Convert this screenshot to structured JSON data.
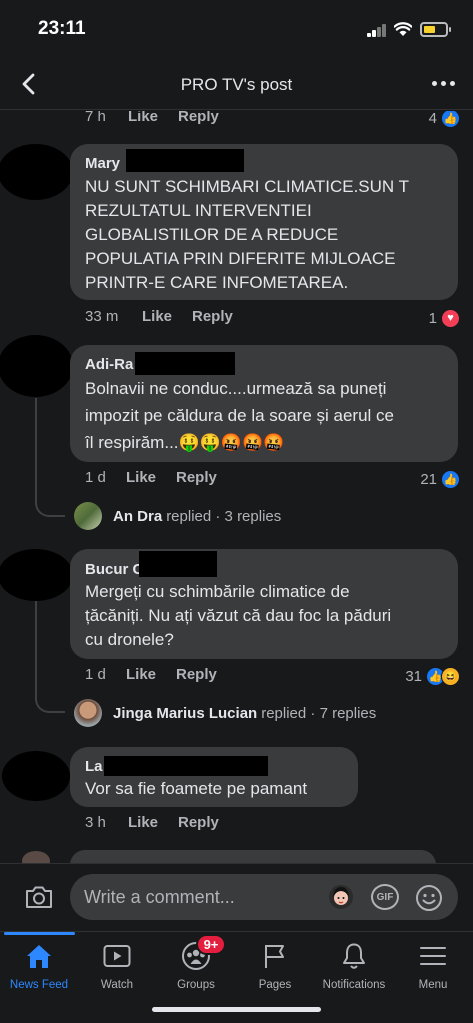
{
  "status_bar": {
    "time": "23:11"
  },
  "header": {
    "title": "PRO TV's post"
  },
  "comments": [
    {
      "time": "7 h",
      "like_label": "Like",
      "reply_label": "Reply",
      "reaction_count": "4",
      "reactions": [
        "like"
      ]
    },
    {
      "author": "Mary",
      "text": "NU SUNT SCHIMBARI CLIMATICE.SUN T\nREZULTATUL INTERVENTIEI\nGLOBALISTILOR DE A REDUCE\nPOPULATIA PRIN DIFERITE MIJLOACE\nPRINTR-E CARE INFOMETAREA.",
      "time": "33 m",
      "like_label": "Like",
      "reply_label": "Reply",
      "reaction_count": "1",
      "reactions": [
        "love"
      ]
    },
    {
      "author": "Adi-Ra",
      "text": "Bolnavii ne conduc....urmează sa puneți\nimpozit pe căldura de la soare și aerul ce\nîl respirăm...🤑🤑🤬🤬🤬",
      "time": "1 d",
      "like_label": "Like",
      "reply_label": "Reply",
      "reaction_count": "21",
      "reactions": [
        "like"
      ],
      "replies": {
        "name": "An Dra",
        "action": "replied",
        "count": "· 3 replies"
      }
    },
    {
      "author": "Bucur C",
      "text": "Mergeți cu schimbările climatice de\nțăcăniți. Nu ați văzut că dau foc la păduri\ncu dronele?",
      "time": "1 d",
      "like_label": "Like",
      "reply_label": "Reply",
      "reaction_count": "31",
      "reactions": [
        "like",
        "haha"
      ],
      "replies": {
        "name": "Jinga Marius Lucian",
        "action": "replied",
        "count": "· 7 replies"
      }
    },
    {
      "author": "La",
      "text": "Vor sa fie foamete pe pamant",
      "time": "3 h",
      "like_label": "Like",
      "reply_label": "Reply"
    }
  ],
  "composer": {
    "placeholder": "Write a comment...",
    "gif_label": "GIF"
  },
  "tabs": [
    {
      "label": "News Feed",
      "icon": "home-icon",
      "active": true
    },
    {
      "label": "Watch",
      "icon": "watch-icon"
    },
    {
      "label": "Groups",
      "icon": "groups-icon",
      "badge": "9+"
    },
    {
      "label": "Pages",
      "icon": "flag-icon"
    },
    {
      "label": "Notifications",
      "icon": "bell-icon"
    },
    {
      "label": "Menu",
      "icon": "menu-icon"
    }
  ],
  "colors": {
    "background": "#18191a",
    "bubble": "#3a3b3c",
    "accent": "#2d88ff",
    "badge": "#e41e3f",
    "love": "#f33e58"
  }
}
